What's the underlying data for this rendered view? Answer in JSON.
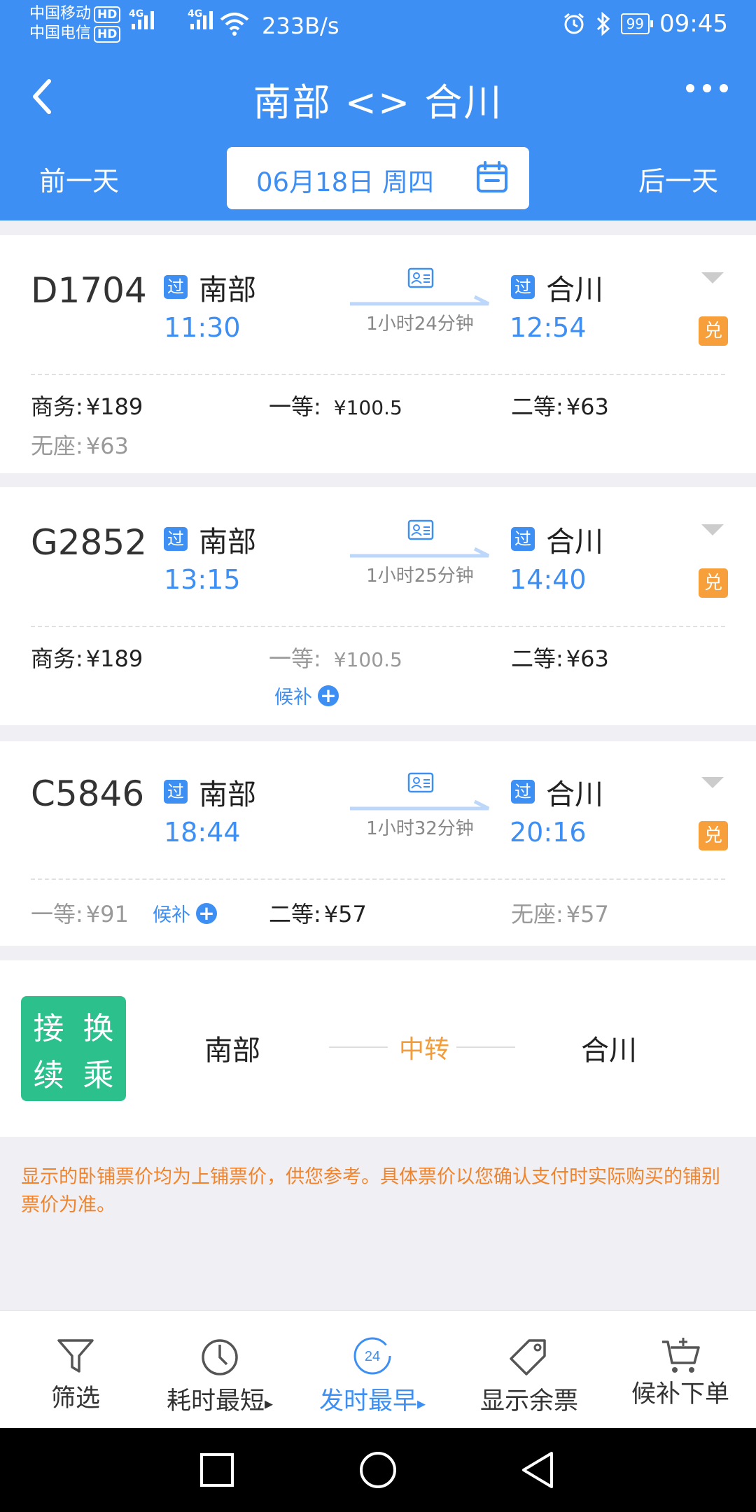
{
  "status_bar": {
    "carrier1": "中国移动",
    "carrier2": "中国电信",
    "hd": "HD",
    "net_label": "4G",
    "net_speed": "233B/s",
    "battery": "99",
    "time": "09:45"
  },
  "nav": {
    "title": "南部 <> 合川"
  },
  "date_bar": {
    "prev": "前一天",
    "date": "06月18日 周四",
    "next": "后一天"
  },
  "trains": [
    {
      "number": "D1704",
      "from_tag": "过",
      "from": "南部",
      "depart": "11:30",
      "duration": "1小时24分钟",
      "to_tag": "过",
      "to": "合川",
      "arrive": "12:54",
      "exchange": "兑",
      "seats": [
        {
          "label": "商务:",
          "value": "¥189"
        },
        {
          "label": "一等:",
          "value": "¥100.5"
        },
        {
          "label": "二等:",
          "value": "¥63"
        },
        {
          "label": "无座:",
          "value": "¥63"
        }
      ]
    },
    {
      "number": "G2852",
      "from_tag": "过",
      "from": "南部",
      "depart": "13:15",
      "duration": "1小时25分钟",
      "to_tag": "过",
      "to": "合川",
      "arrive": "14:40",
      "exchange": "兑",
      "seats": [
        {
          "label": "商务:",
          "value": "¥189"
        },
        {
          "label": "一等:",
          "value": "¥100.5"
        },
        {
          "label": "二等:",
          "value": "¥63"
        }
      ],
      "waitlist": "候补"
    },
    {
      "number": "C5846",
      "from_tag": "过",
      "from": "南部",
      "depart": "18:44",
      "duration": "1小时32分钟",
      "to_tag": "过",
      "to": "合川",
      "arrive": "20:16",
      "exchange": "兑",
      "seats": [
        {
          "label": "一等:",
          "value": "¥91"
        },
        {
          "label": "二等:",
          "value": "¥57"
        },
        {
          "label": "无座:",
          "value": "¥57"
        }
      ],
      "waitlist": "候补"
    }
  ],
  "transfer": {
    "badge": [
      "接",
      "换",
      "续",
      "乘"
    ],
    "from": "南部",
    "mid": "中转",
    "to": "合川"
  },
  "notice": "显示的卧铺票价均为上铺票价，供您参考。具体票价以您确认支付时实际购买的铺别票价为准。",
  "toolbar": {
    "filter": "筛选",
    "shortest": "耗时最短",
    "earliest": "发时最早",
    "clock_num": "24",
    "remaining": "显示余票",
    "waitlist_order": "候补下单",
    "sort_mark": "▸"
  },
  "colors": {
    "brand_blue": "#3d8ff3",
    "exchange_orange": "#f7a03b",
    "transfer_green": "#2cc08d",
    "notice_orange": "#f0842c"
  }
}
